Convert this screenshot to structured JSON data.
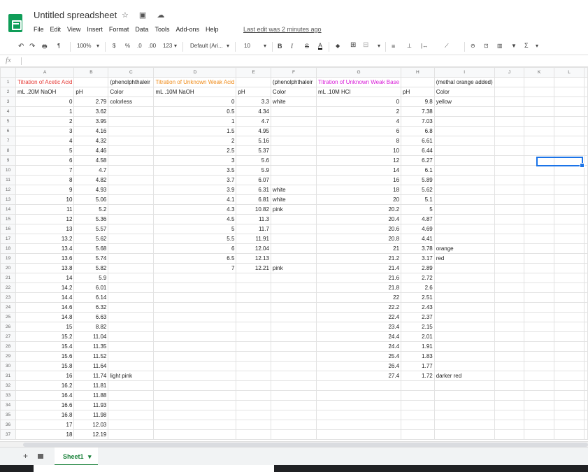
{
  "app": {
    "title": "Untitled spreadsheet",
    "title_icons": "☆ ▣ ☁",
    "menu": [
      "File",
      "Edit",
      "View",
      "Insert",
      "Format",
      "Data",
      "Tools",
      "Add-ons",
      "Help"
    ],
    "last_edit": "Last edit was 2 minutes ago"
  },
  "toolbar": {
    "undo": "↶",
    "redo": "↷",
    "print": "🖶",
    "paint": "¶",
    "zoom": "100%",
    "currency": "$",
    "percent": "%",
    "dec_less": ".0",
    "dec_more": ".00",
    "more_formats": "123",
    "font": "Default (Ari...",
    "font_size": "10",
    "bold": "B",
    "italic": "I",
    "strike": "S",
    "color": "A",
    "fill": "◆",
    "borders": "⊞",
    "merge": "⊟",
    "halign": "≡",
    "valign": "⊥",
    "wrap": "|↔",
    "rotate": "⟋",
    "link": "⊝",
    "comment": "⊡",
    "chart": "▥",
    "filter": "▼",
    "functions": "Σ"
  },
  "formula_bar": {
    "fx": "fx",
    "value": ""
  },
  "columns": [
    "A",
    "B",
    "C",
    "D",
    "E",
    "F",
    "G",
    "H",
    "I",
    "J",
    "K",
    "L"
  ],
  "rows": [
    [
      "Titration of Acetic Acid",
      "",
      "(phenolphthaleir",
      "Titration of Unknown Weak Acid",
      "",
      "(phenolphthaleir",
      "Titration of Unknown Weak Base",
      "",
      "(methal orange added)",
      "",
      "",
      ""
    ],
    [
      "mL .20M NaOH",
      "pH",
      "Color",
      "mL .10M NaOH",
      "pH",
      "Color",
      "mL .10M HCl",
      "pH",
      "Color",
      "",
      "",
      ""
    ],
    [
      "0",
      "2.79",
      "colorless",
      "0",
      "3.3",
      "white",
      "0",
      "9.8",
      "yellow",
      "",
      "",
      ""
    ],
    [
      "1",
      "3.62",
      "",
      "0.5",
      "4.34",
      "",
      "2",
      "7.38",
      "",
      "",
      "",
      ""
    ],
    [
      "2",
      "3.95",
      "",
      "1",
      "4.7",
      "",
      "4",
      "7.03",
      "",
      "",
      "",
      ""
    ],
    [
      "3",
      "4.16",
      "",
      "1.5",
      "4.95",
      "",
      "6",
      "6.8",
      "",
      "",
      "",
      ""
    ],
    [
      "4",
      "4.32",
      "",
      "2",
      "5.16",
      "",
      "8",
      "6.61",
      "",
      "",
      "",
      ""
    ],
    [
      "5",
      "4.46",
      "",
      "2.5",
      "5.37",
      "",
      "10",
      "6.44",
      "",
      "",
      "",
      ""
    ],
    [
      "6",
      "4.58",
      "",
      "3",
      "5.6",
      "",
      "12",
      "6.27",
      "",
      "",
      "",
      ""
    ],
    [
      "7",
      "4.7",
      "",
      "3.5",
      "5.9",
      "",
      "14",
      "6.1",
      "",
      "",
      "",
      ""
    ],
    [
      "8",
      "4.82",
      "",
      "3.7",
      "6.07",
      "",
      "16",
      "5.89",
      "",
      "",
      "",
      ""
    ],
    [
      "9",
      "4.93",
      "",
      "3.9",
      "6.31",
      "white",
      "18",
      "5.62",
      "",
      "",
      "",
      ""
    ],
    [
      "10",
      "5.06",
      "",
      "4.1",
      "6.81",
      "white",
      "20",
      "5.1",
      "",
      "",
      "",
      ""
    ],
    [
      "11",
      "5.2",
      "",
      "4.3",
      "10.82",
      "pink",
      "20.2",
      "5",
      "",
      "",
      "",
      ""
    ],
    [
      "12",
      "5.36",
      "",
      "4.5",
      "11.3",
      "",
      "20.4",
      "4.87",
      "",
      "",
      "",
      ""
    ],
    [
      "13",
      "5.57",
      "",
      "5",
      "11.7",
      "",
      "20.6",
      "4.69",
      "",
      "",
      "",
      ""
    ],
    [
      "13.2",
      "5.62",
      "",
      "5.5",
      "11.91",
      "",
      "20.8",
      "4.41",
      "",
      "",
      "",
      ""
    ],
    [
      "13.4",
      "5.68",
      "",
      "6",
      "12.04",
      "",
      "21",
      "3.78",
      "orange",
      "",
      "",
      ""
    ],
    [
      "13.6",
      "5.74",
      "",
      "6.5",
      "12.13",
      "",
      "21.2",
      "3.17",
      "red",
      "",
      "",
      ""
    ],
    [
      "13.8",
      "5.82",
      "",
      "7",
      "12.21",
      "pink",
      "21.4",
      "2.89",
      "",
      "",
      "",
      ""
    ],
    [
      "14",
      "5.9",
      "",
      "",
      "",
      "",
      "21.6",
      "2.72",
      "",
      "",
      "",
      ""
    ],
    [
      "14.2",
      "6.01",
      "",
      "",
      "",
      "",
      "21.8",
      "2.6",
      "",
      "",
      "",
      ""
    ],
    [
      "14.4",
      "6.14",
      "",
      "",
      "",
      "",
      "22",
      "2.51",
      "",
      "",
      "",
      ""
    ],
    [
      "14.6",
      "6.32",
      "",
      "",
      "",
      "",
      "22.2",
      "2.43",
      "",
      "",
      "",
      ""
    ],
    [
      "14.8",
      "6.63",
      "",
      "",
      "",
      "",
      "22.4",
      "2.37",
      "",
      "",
      "",
      ""
    ],
    [
      "15",
      "8.82",
      "",
      "",
      "",
      "",
      "23.4",
      "2.15",
      "",
      "",
      "",
      ""
    ],
    [
      "15.2",
      "11.04",
      "",
      "",
      "",
      "",
      "24.4",
      "2.01",
      "",
      "",
      "",
      ""
    ],
    [
      "15.4",
      "11.35",
      "",
      "",
      "",
      "",
      "24.4",
      "1.91",
      "",
      "",
      "",
      ""
    ],
    [
      "15.6",
      "11.52",
      "",
      "",
      "",
      "",
      "25.4",
      "1.83",
      "",
      "",
      "",
      ""
    ],
    [
      "15.8",
      "11.64",
      "",
      "",
      "",
      "",
      "26.4",
      "1.77",
      "",
      "",
      "",
      ""
    ],
    [
      "16",
      "11.74",
      "light pink",
      "",
      "",
      "",
      "27.4",
      "1.72",
      "darker red",
      "",
      "",
      ""
    ],
    [
      "16.2",
      "11.81",
      "",
      "",
      "",
      "",
      "",
      "",
      "",
      "",
      "",
      ""
    ],
    [
      "16.4",
      "11.88",
      "",
      "",
      "",
      "",
      "",
      "",
      "",
      "",
      "",
      ""
    ],
    [
      "16.6",
      "11.93",
      "",
      "",
      "",
      "",
      "",
      "",
      "",
      "",
      "",
      ""
    ],
    [
      "16.8",
      "11.98",
      "",
      "",
      "",
      "",
      "",
      "",
      "",
      "",
      "",
      ""
    ],
    [
      "17",
      "12.03",
      "",
      "",
      "",
      "",
      "",
      "",
      "",
      "",
      "",
      ""
    ],
    [
      "18",
      "12.19",
      "",
      "",
      "",
      "",
      "",
      "",
      "",
      "",
      "",
      ""
    ]
  ],
  "row1_colors": {
    "A": "#e53935",
    "D": "#ef8a17",
    "G": "#d81bd8"
  },
  "selected_cell": "L9",
  "sheet_tabs": [
    {
      "label": "Sheet1",
      "active": true
    }
  ],
  "sheetbar": {
    "add": "+",
    "tab_caret": "▾"
  }
}
